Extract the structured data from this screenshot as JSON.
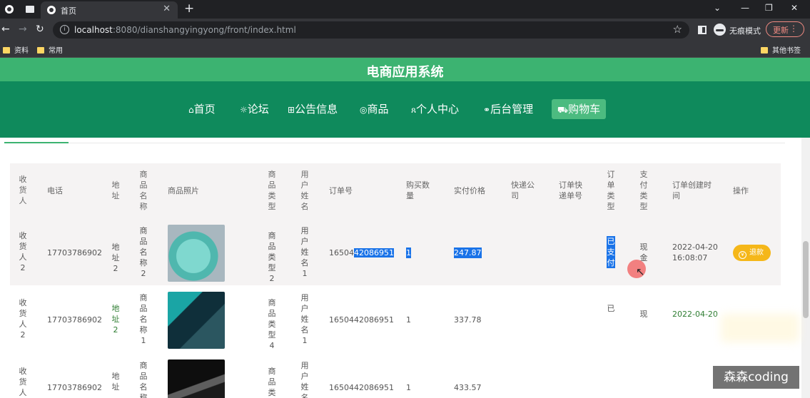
{
  "browser": {
    "tab_title": "首页",
    "new_tab": "+",
    "url_host": "localhost",
    "url_rest": ":8080/dianshangyingyong/front/index.html",
    "incognito_label": "无痕模式",
    "update_label": "更新",
    "bookmarks": [
      "资料",
      "常用"
    ],
    "other_bookmarks": "其他书签"
  },
  "site": {
    "title": "电商应用系统",
    "nav": [
      {
        "icon": "⌂",
        "label": "首页"
      },
      {
        "icon": "☼",
        "label": "论坛"
      },
      {
        "icon": "⊞",
        "label": "公告信息"
      },
      {
        "icon": "◎",
        "label": "商品"
      },
      {
        "icon": "ጸ",
        "label": "个人中心"
      },
      {
        "icon": "⚭",
        "label": "后台管理"
      },
      {
        "icon": "⛟",
        "label": "购物车"
      }
    ]
  },
  "table": {
    "headers": {
      "receiver": "收货人",
      "phone": "电话",
      "address": "地址",
      "product_name": "商品名称",
      "product_photo": "商品照片",
      "product_type": "商品类型",
      "username": "用户姓名",
      "order_no": "订单号",
      "quantity": "购买数量",
      "price": "实付价格",
      "courier": "快递公司",
      "tracking": "订单快递单号",
      "order_type": "订单类型",
      "pay_type": "支付类型",
      "created": "订单创建时间",
      "action": "操作"
    },
    "rows": [
      {
        "receiver": "收货人2",
        "phone": "17703786902",
        "address": "地址2",
        "product_name": "商品名称2",
        "product_type": "商品类型2",
        "username": "用户姓名1",
        "order_no_a": "16504",
        "order_no_b": "42086951",
        "quantity": "1",
        "price": "247.87",
        "order_type": "已支付",
        "pay_type": "现金",
        "created": "2022-04-20 16:08:07",
        "action": "退款"
      },
      {
        "receiver": "收货人2",
        "phone": "17703786902",
        "address": "地址2",
        "product_name": "商品名称1",
        "product_type": "商品类型4",
        "username": "用户姓名1",
        "order_no": "1650442086951",
        "quantity": "1",
        "price": "337.78",
        "order_type": "已",
        "pay_type": "现",
        "created": "2022-04-20"
      },
      {
        "receiver": "收货人",
        "phone": "17703786902",
        "address": "地址",
        "product_name": "商品名称",
        "product_type": "商品类",
        "username": "用户姓名",
        "order_no": "1650442086951",
        "quantity": "1",
        "price": "433.57"
      }
    ]
  },
  "watermark": "森森coding"
}
